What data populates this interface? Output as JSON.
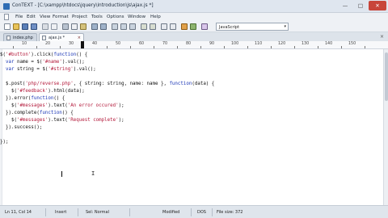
{
  "window": {
    "title": "ConTEXT - [C:\\xampp\\htdocs\\jquery\\introduction\\js\\ajax.js *]"
  },
  "menu": [
    "File",
    "Edit",
    "View",
    "Format",
    "Project",
    "Tools",
    "Options",
    "Window",
    "Help"
  ],
  "toolbar": {
    "language": "JavaScript"
  },
  "tabs": [
    {
      "label": "index.php",
      "active": false
    },
    {
      "label": "ajax.js *",
      "active": true
    }
  ],
  "ruler": {
    "marks": [
      "10",
      "20",
      "30",
      "40",
      "50",
      "60",
      "70",
      "80",
      "90",
      "100",
      "110",
      "120",
      "130",
      "140",
      "150"
    ]
  },
  "code": [
    "$('#button').click(function() {",
    "  var name = $('#name').val();",
    "  var string = $('#string').val();",
    "",
    "  $.post('php/reverse.php', { string: string, name: name }, function(data) {",
    "    $('#feedback').html(data);",
    "  }).error(function() {",
    "    $('#messages').text('An error occured');",
    "  }).complete(function() {",
    "    $('#messages').text('Request complete');",
    "  }).success();",
    "",
    "});"
  ],
  "status": {
    "position": "Ln 11, Col 14",
    "insert": "Insert",
    "selection": "Sel: Normal",
    "modified": "Modified",
    "encoding": "DOS",
    "filesize": "File size: 372"
  }
}
